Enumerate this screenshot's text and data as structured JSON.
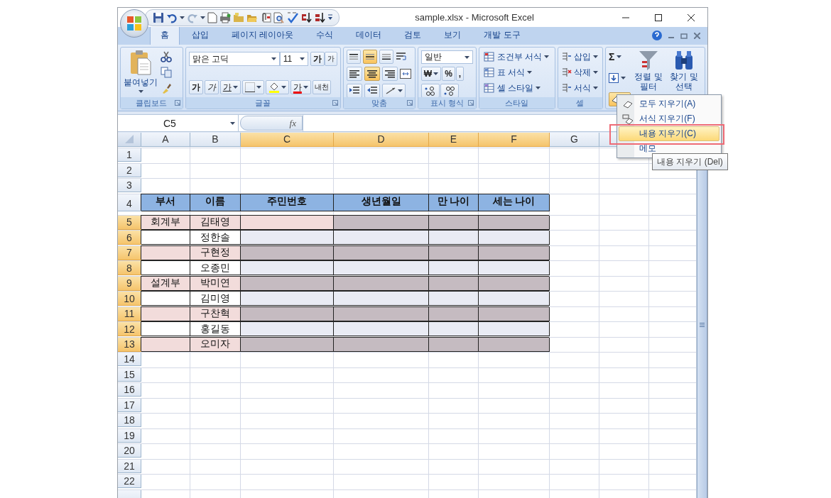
{
  "window": {
    "title": "sample.xlsx - Microsoft Excel"
  },
  "tabs": [
    {
      "label": "홈",
      "selected": true
    },
    {
      "label": "삽입",
      "selected": false
    },
    {
      "label": "페이지 레이아웃",
      "selected": false
    },
    {
      "label": "수식",
      "selected": false
    },
    {
      "label": "데이터",
      "selected": false
    },
    {
      "label": "검토",
      "selected": false
    },
    {
      "label": "보기",
      "selected": false
    },
    {
      "label": "개발 도구",
      "selected": false
    }
  ],
  "ribbon": {
    "clipboard": {
      "label": "클립보드",
      "paste": "붙여넣기"
    },
    "font": {
      "label": "글꼴",
      "font_name": "맑은 고딕",
      "font_size": "11",
      "grow": "가",
      "shrink": "가",
      "bold": "가",
      "italic": "가",
      "underline": "가",
      "font_color": "가",
      "phonetic": "내천"
    },
    "alignment": {
      "label": "맞춤",
      "vertical": [
        {
          "selected": false
        },
        {
          "selected": true
        },
        {
          "selected": false
        }
      ],
      "horizontal": [
        {
          "selected": false
        },
        {
          "selected": true
        },
        {
          "selected": false
        }
      ]
    },
    "number": {
      "label": "표시 형식",
      "format": "일반",
      "currency": "₩",
      "percent": "%",
      "comma": ","
    },
    "styles": {
      "label": "스타일",
      "items": [
        "조건부 서식",
        "표 서식",
        "셀 스타일"
      ]
    },
    "cells": {
      "label": "셀",
      "items": [
        "삽입",
        "삭제",
        "서식"
      ]
    },
    "editing": {
      "autosum": "Σ",
      "clear_pressed": true,
      "sort": "정렬 및 필터",
      "find": "찾기 및 선택"
    }
  },
  "formula_bar": {
    "name_box": "C5",
    "function_label": "fx"
  },
  "sheet": {
    "columns": [
      {
        "label": "A",
        "selected": false
      },
      {
        "label": "B",
        "selected": false
      },
      {
        "label": "C",
        "selected": true
      },
      {
        "label": "D",
        "selected": true
      },
      {
        "label": "E",
        "selected": true
      },
      {
        "label": "F",
        "selected": true
      },
      {
        "label": "G",
        "selected": false
      }
    ],
    "rows": [
      {
        "label": "1",
        "selected": false,
        "kind": "blank"
      },
      {
        "label": "2",
        "selected": false,
        "kind": "blank"
      },
      {
        "label": "3",
        "selected": false,
        "kind": "blank"
      },
      {
        "label": "4",
        "selected": false,
        "kind": "header",
        "cells": [
          {
            "text": "부서",
            "color": "#8db3e2"
          },
          {
            "text": "이름",
            "color": "#8db3e2"
          },
          {
            "text": "주민번호",
            "color": "#8db3e2"
          },
          {
            "text": "생년월일",
            "color": "#8db3e2"
          },
          {
            "text": "만 나이",
            "color": "#8db3e2"
          },
          {
            "text": "세는 나이",
            "color": "#8db3e2"
          }
        ]
      },
      {
        "label": "5",
        "selected": true,
        "kind": "data",
        "cells": [
          {
            "text": "회계부",
            "color": "#f2dcdb"
          },
          {
            "text": "김태영",
            "color": "#f2dcdb"
          },
          {
            "color": "#f2dcdb"
          },
          {
            "color": "#c5bbc1"
          },
          {
            "color": "#c5bbc1"
          },
          {
            "color": "#c5bbc1"
          }
        ]
      },
      {
        "label": "6",
        "selected": true,
        "kind": "data",
        "cells": [
          {
            "color": "#ffffff"
          },
          {
            "text": "정한솔",
            "color": "#ffffff"
          },
          {
            "color": "#e9ebf4"
          },
          {
            "color": "#e9ebf4"
          },
          {
            "color": "#e9ebf4"
          },
          {
            "color": "#e9ebf4"
          }
        ]
      },
      {
        "label": "7",
        "selected": true,
        "kind": "data",
        "cells": [
          {
            "color": "#f2dcdb"
          },
          {
            "text": "구현정",
            "color": "#f2dcdb"
          },
          {
            "color": "#c5bbc1"
          },
          {
            "color": "#c5bbc1"
          },
          {
            "color": "#c5bbc1"
          },
          {
            "color": "#c5bbc1"
          }
        ]
      },
      {
        "label": "8",
        "selected": true,
        "kind": "data",
        "cells": [
          {
            "color": "#ffffff"
          },
          {
            "text": "오종민",
            "color": "#ffffff"
          },
          {
            "color": "#e9ebf4"
          },
          {
            "color": "#e9ebf4"
          },
          {
            "color": "#e9ebf4"
          },
          {
            "color": "#e9ebf4"
          }
        ]
      },
      {
        "label": "9",
        "selected": true,
        "kind": "data",
        "cells": [
          {
            "text": "설계부",
            "color": "#f2dcdb"
          },
          {
            "text": "박미연",
            "color": "#f2dcdb"
          },
          {
            "color": "#c5bbc1"
          },
          {
            "color": "#c5bbc1"
          },
          {
            "color": "#c5bbc1"
          },
          {
            "color": "#c5bbc1"
          }
        ]
      },
      {
        "label": "10",
        "selected": true,
        "kind": "data",
        "cells": [
          {
            "color": "#ffffff"
          },
          {
            "text": "김미영",
            "color": "#ffffff"
          },
          {
            "color": "#e9ebf4"
          },
          {
            "color": "#e9ebf4"
          },
          {
            "color": "#e9ebf4"
          },
          {
            "color": "#e9ebf4"
          }
        ]
      },
      {
        "label": "11",
        "selected": true,
        "kind": "data",
        "cells": [
          {
            "color": "#f2dcdb"
          },
          {
            "text": "구찬혁",
            "color": "#f2dcdb"
          },
          {
            "color": "#c5bbc1"
          },
          {
            "color": "#c5bbc1"
          },
          {
            "color": "#c5bbc1"
          },
          {
            "color": "#c5bbc1"
          }
        ]
      },
      {
        "label": "12",
        "selected": true,
        "kind": "data",
        "cells": [
          {
            "color": "#ffffff"
          },
          {
            "text": "홍길동",
            "color": "#ffffff"
          },
          {
            "color": "#e9ebf4"
          },
          {
            "color": "#e9ebf4"
          },
          {
            "color": "#e9ebf4"
          },
          {
            "color": "#e9ebf4"
          }
        ]
      },
      {
        "label": "13",
        "selected": true,
        "kind": "data",
        "cells": [
          {
            "color": "#f2dcdb"
          },
          {
            "text": "오미자",
            "color": "#f2dcdb"
          },
          {
            "color": "#c5bbc1"
          },
          {
            "color": "#c5bbc1"
          },
          {
            "color": "#c5bbc1"
          },
          {
            "color": "#c5bbc1"
          }
        ]
      },
      {
        "label": "14",
        "selected": false,
        "kind": "blank"
      },
      {
        "label": "15",
        "selected": false,
        "kind": "blank"
      },
      {
        "label": "16",
        "selected": false,
        "kind": "blank"
      },
      {
        "label": "17",
        "selected": false,
        "kind": "blank"
      },
      {
        "label": "18",
        "selected": false,
        "kind": "blank"
      },
      {
        "label": "19",
        "selected": false,
        "kind": "blank"
      },
      {
        "label": "20",
        "selected": false,
        "kind": "blank"
      },
      {
        "label": "21",
        "selected": false,
        "kind": "blank"
      },
      {
        "label": "22",
        "selected": false,
        "kind": "blank"
      }
    ]
  },
  "clear_menu": {
    "items": [
      {
        "label": "모두 지우기(A)",
        "selected": false
      },
      {
        "label": "서식 지우기(F)",
        "selected": false
      },
      {
        "label": "내용 지우기(C)",
        "selected": true
      },
      {
        "label": "메모",
        "selected": false
      }
    ]
  },
  "tooltip": "내용 지우기 (Del)"
}
